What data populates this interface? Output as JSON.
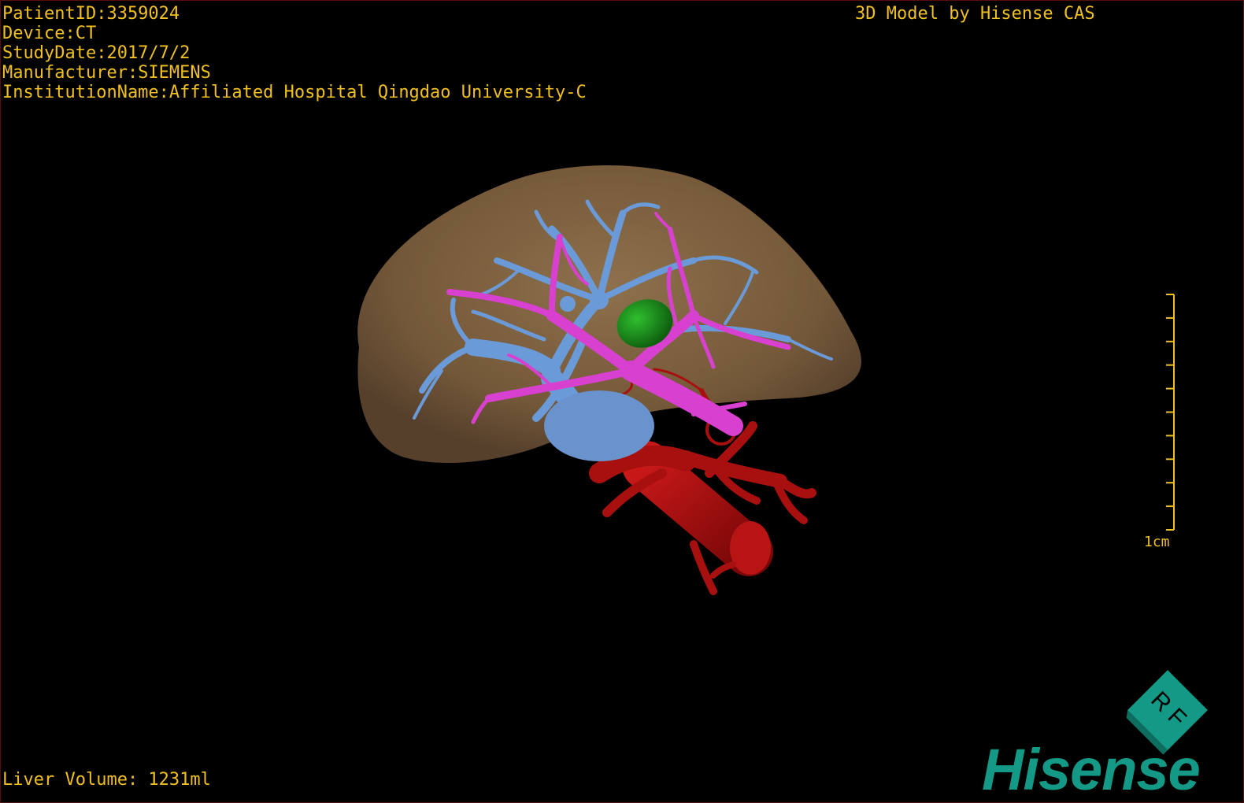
{
  "header": {
    "patient_id": "PatientID:3359024",
    "device": "Device:CT",
    "study_date": "StudyDate:2017/7/2",
    "manufacturer": "Manufacturer:SIEMENS",
    "institution": "InstitutionName:Affiliated Hospital Qingdao University-C"
  },
  "title": "3D Model by Hisense CAS",
  "footer": {
    "liver_volume": "Liver Volume: 1231ml"
  },
  "scale": {
    "label": "1cm",
    "tick_count": 10
  },
  "orientation": {
    "letters": "R F",
    "color": "#139986"
  },
  "brand": {
    "logo_text": "Hisense",
    "color": "#139986"
  },
  "colors": {
    "text": "#f0c020",
    "liver": "#8a6a45",
    "hepatic_vein": "#6a9ad8",
    "portal_vein": "#d840d0",
    "artery": "#b01010",
    "lesion": "#1a8a1a",
    "background": "#000000"
  },
  "icons": {
    "orientation_cube": "orientation-cube-icon",
    "scale_bar": "scale-bar-icon"
  }
}
